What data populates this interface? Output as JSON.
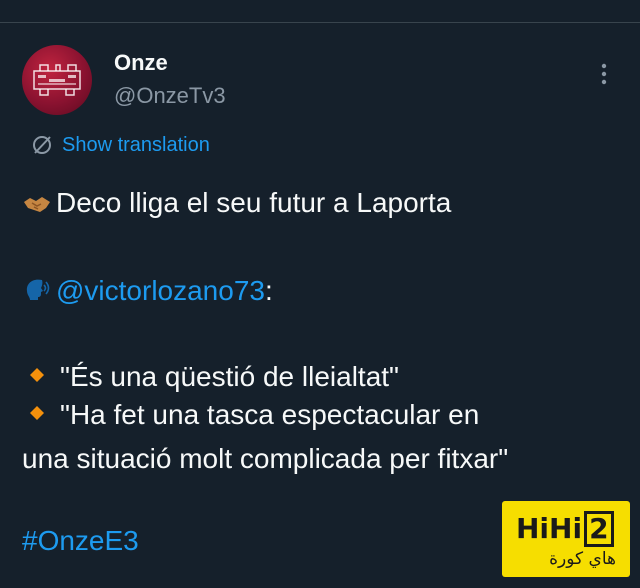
{
  "tweet": {
    "author_name": "Onze",
    "author_handle": "@OnzeTv3",
    "show_translation": "Show translation",
    "line1_text": "Deco lliga el seu futur a Laporta",
    "mention": "@victorlozano73",
    "mention_suffix": ":",
    "quote1": "\"És una qüestió de lleialtat\"",
    "quote2_a": "\"Ha fet una tasca espectacular en",
    "quote2_b": "una situació molt complicada per fitxar\"",
    "hashtag": "#OnzeE3"
  },
  "watermark": {
    "logo_text": "HiHi",
    "logo_boxed": "2",
    "subtitle": "هاي كورة"
  },
  "icons": {
    "handshake": "handshake-icon",
    "speaking_head": "speaking-head-icon",
    "diamond": "orange-diamond-icon",
    "translate": "translate-icon",
    "more": "more-vertical-icon"
  },
  "colors": {
    "background": "#15202b",
    "text": "#f7f9f9",
    "secondary": "#8b98a5",
    "accent": "#1d9bf0",
    "watermark_bg": "#f6de00"
  }
}
